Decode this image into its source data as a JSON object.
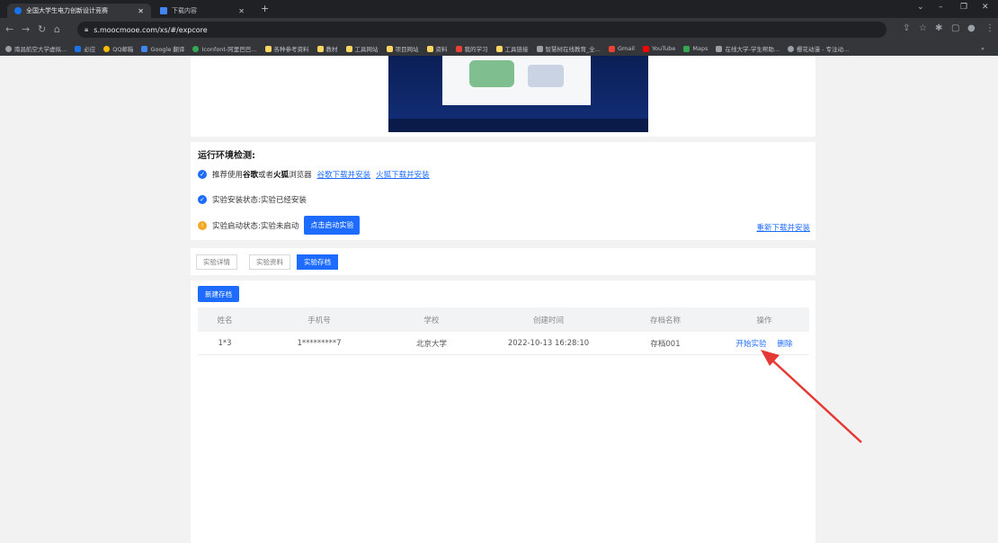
{
  "browser": {
    "tabs": [
      {
        "title": "全国大学生电力创新设计竞赛"
      },
      {
        "title": "下载内容"
      }
    ],
    "new_tab": "+",
    "window_controls": {
      "minimize": "–",
      "maximize": "❐",
      "close": "✕",
      "menu": "⌄"
    },
    "url": "s.moocmooe.com/xs/#/expcore",
    "bookmarks": [
      "南昌航空大学虚拟...",
      "必应",
      "QQ邮箱",
      "Google 翻译",
      "Iconfont-阿里巴巴...",
      "各种参考资料",
      "教材",
      "工具网站",
      "项目网站",
      "资料",
      "我的学习",
      "工具链接",
      "智慧树在线教育_全...",
      "Gmail",
      "YouTube",
      "Maps",
      "在线大学-学生帮助...",
      "樱花动漫 - 专注动..."
    ],
    "bookmarks_overflow": "»"
  },
  "env": {
    "title": "运行环境检测:",
    "browser_prefix": "推荐使用",
    "browser_chrome": "谷歌",
    "browser_or": "或者",
    "browser_firefox": "火狐",
    "browser_suffix": "浏览器",
    "chrome_link": "谷歌下载并安装",
    "firefox_link": "火狐下载并安装",
    "install_status": "实验安装状态:实验已经安装",
    "launch_status": "实验启动状态:实验未启动",
    "launch_button": "点击启动实验",
    "reinstall_link": "重新下载并安装"
  },
  "tabs": [
    "实验详情",
    "实验资料",
    "实验存档"
  ],
  "active_tab": "实验存档",
  "archive": {
    "new_button": "新建存档",
    "columns": [
      "姓名",
      "手机号",
      "学校",
      "创建时间",
      "存档名称",
      "操作"
    ],
    "rows": [
      {
        "name": "1*3",
        "phone": "1*********7",
        "school": "北京大学",
        "created": "2022-10-13 16:28:10",
        "archive_name": "存档001",
        "action_start": "开始实验",
        "action_delete": "删除"
      }
    ]
  },
  "colors": {
    "accent": "#1d6cff",
    "warning": "#f5a623",
    "annotation_arrow": "#e53935"
  }
}
